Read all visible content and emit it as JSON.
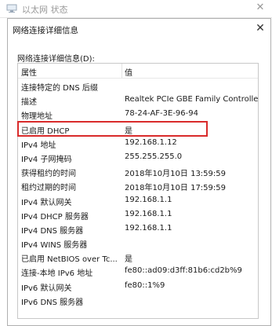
{
  "parent_window": {
    "title": "以太网 状态"
  },
  "dialog": {
    "title": "网络连接详细信息",
    "section_label": "网络连接详细信息(D):",
    "columns": {
      "property": "属性",
      "value": "值"
    },
    "rows": [
      {
        "property": "连接特定的 DNS 后缀",
        "value": ""
      },
      {
        "property": "描述",
        "value": "Realtek PCIe GBE Family Controller"
      },
      {
        "property": "物理地址",
        "value": "78-24-AF-3E-96-94"
      },
      {
        "property": "已启用 DHCP",
        "value": "是"
      },
      {
        "property": "IPv4 地址",
        "value": "192.168.1.12"
      },
      {
        "property": "IPv4 子网掩码",
        "value": "255.255.255.0"
      },
      {
        "property": "获得租约的时间",
        "value": "2018年10月10日 13:59:59"
      },
      {
        "property": "租约过期的时间",
        "value": "2018年10月10日 17:59:59"
      },
      {
        "property": "IPv4 默认网关",
        "value": "192.168.1.1"
      },
      {
        "property": "IPv4 DHCP 服务器",
        "value": "192.168.1.1"
      },
      {
        "property": "IPv4 DNS 服务器",
        "value": "192.168.1.1"
      },
      {
        "property": "IPv4 WINS 服务器",
        "value": ""
      },
      {
        "property": "已启用 NetBIOS over Tc...",
        "value": "是"
      },
      {
        "property": "连接-本地 IPv6 地址",
        "value": "fe80::ad09:d3ff:81b6:cd2b%9"
      },
      {
        "property": "IPv6 默认网关",
        "value": "fe80::1%9"
      },
      {
        "property": "IPv6 DNS 服务器",
        "value": ""
      }
    ],
    "highlighted_row": "物理地址",
    "highlight_color": "#d92b2b"
  },
  "icons": {
    "parent_icon": "network-adapter-icon",
    "parent_close": "close-icon",
    "dialog_close": "close-icon"
  }
}
